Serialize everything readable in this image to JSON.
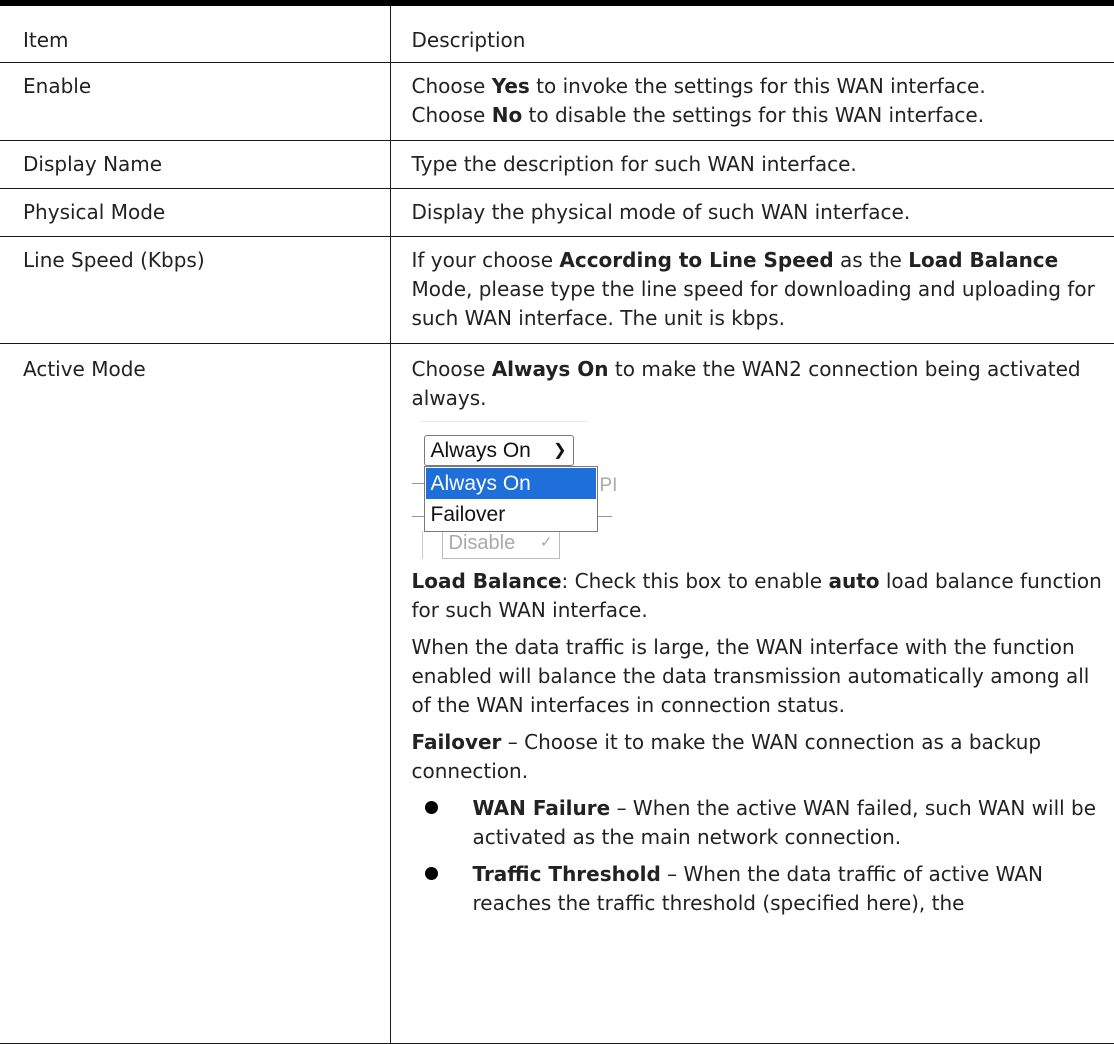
{
  "header": {
    "item": "Item",
    "description": "Description"
  },
  "rows": {
    "enable": {
      "item": "Enable",
      "line1_a": "Choose ",
      "line1_b": "Yes",
      "line1_c": " to invoke the settings for this WAN interface.",
      "line2_a": "Choose ",
      "line2_b": "No",
      "line2_c": " to disable the settings for this WAN interface."
    },
    "display_name": {
      "item": "Display Name",
      "desc": "Type the description for such WAN interface."
    },
    "physical_mode": {
      "item": "Physical Mode",
      "desc": "Display the physical mode of such WAN interface."
    },
    "line_speed": {
      "item": "Line Speed (Kbps)",
      "a": "If your choose ",
      "b": "According to Line Speed",
      "c": " as the ",
      "d": "Load Balance",
      "e": " Mode",
      "f": ", please type the line speed for downloading and uploading for such WAN interface. The unit is kbps."
    },
    "active_mode": {
      "item": "Active Mode",
      "p1_a": "Choose ",
      "p1_b": "Always On",
      "p1_c": " to make the WAN2 connection being activated always.",
      "dropdown": {
        "selected": "Always On",
        "options": [
          "Always On",
          "Failover"
        ],
        "highlighted": "Always On",
        "ghost_right": "PI",
        "ghost_select": "Disable"
      },
      "p2_a": "Load Balance",
      "p2_b": ": Check this box to enable ",
      "p2_c": "auto",
      "p2_d": " load balance function for such WAN interface.",
      "p3": "When the data traffic is large, the WAN interface with the function enabled will balance the data transmission automatically among all of the WAN interfaces in connection status.",
      "p4_a": "Failover",
      "p4_b": " – Choose it to make the WAN connection as a backup connection.",
      "bullets": [
        {
          "term": "WAN Failure",
          "text": " – When the active WAN failed, such WAN will be activated as the main network connection."
        },
        {
          "term": "Traffic Threshold",
          "text": " – When the data traffic of active WAN reaches the traffic threshold (specified here), the"
        }
      ]
    }
  }
}
